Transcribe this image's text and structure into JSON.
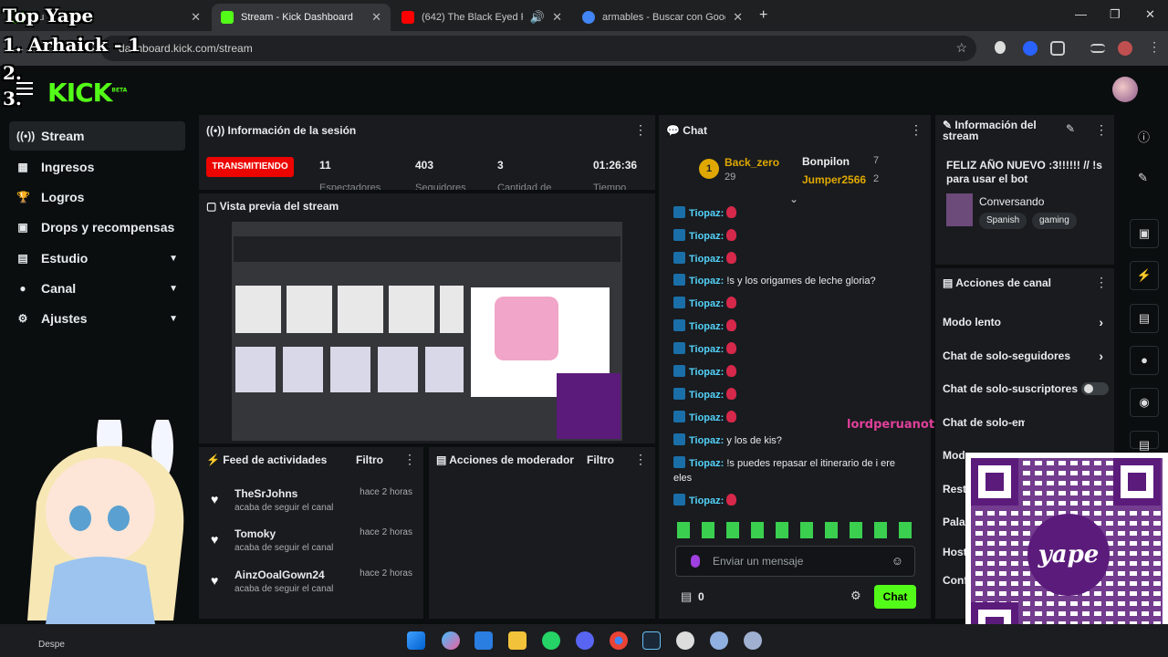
{
  "browser": {
    "tabs": [
      {
        "label": "Tu",
        "favicon_color": "#53fc18"
      },
      {
        "label": "Stream - Kick Dashboard",
        "favicon_color": "#53fc18"
      },
      {
        "label": "(642) The Black Eyed Peas -",
        "favicon_color": "#ff0000"
      },
      {
        "label": "armables - Buscar con Google",
        "favicon_color": "#4285f4"
      }
    ],
    "new_tab": "+",
    "url": "dashboard.kick.com/stream"
  },
  "overlay": {
    "top_yape": "Top Yape",
    "rank1": "1. Arhaick - 1",
    "rank2": "2.",
    "rank3": "3."
  },
  "header": {
    "logo": "KICK",
    "logo_badge": "BETA"
  },
  "sidebar": {
    "items": [
      {
        "label": "Stream",
        "icon": "broadcast-icon"
      },
      {
        "label": "Ingresos",
        "icon": "money-icon"
      },
      {
        "label": "Logros",
        "icon": "trophy-icon"
      },
      {
        "label": "Drops y recompensas",
        "icon": "gift-icon"
      },
      {
        "label": "Estudio",
        "icon": "studio-icon"
      },
      {
        "label": "Canal",
        "icon": "person-icon"
      },
      {
        "label": "Ajustes",
        "icon": "gear-icon"
      }
    ]
  },
  "session": {
    "title": "Información de la sesión",
    "status": "TRANSMITIENDO",
    "stats": [
      {
        "value": "11",
        "label": "Espectadores"
      },
      {
        "value": "403",
        "label": "Seguidores"
      },
      {
        "value": "3",
        "label": "Cantidad de"
      },
      {
        "value": "01:26:36",
        "label": "Tiempo"
      }
    ]
  },
  "preview": {
    "title": "Vista previa del stream"
  },
  "feed": {
    "title": "Feed de actividades",
    "filter": "Filtro",
    "items": [
      {
        "name": "TheSrJohns",
        "action": "acaba de seguir el canal",
        "time": "hace 2 horas"
      },
      {
        "name": "Tomoky",
        "action": "acaba de seguir el canal",
        "time": "hace 2 horas"
      },
      {
        "name": "AinzOoalGown24",
        "action": "acaba de seguir el canal",
        "time": "hace 2 horas"
      }
    ]
  },
  "mod": {
    "title": "Acciones de moderador",
    "filter": "Filtro"
  },
  "chat": {
    "title": "Chat",
    "leaderboard": [
      {
        "rank": "1",
        "name": "Back_zero",
        "points": "29"
      },
      {
        "name": "Bonpilon",
        "points": "7"
      },
      {
        "name": "Jumper2566",
        "points": "2"
      }
    ],
    "messages": [
      {
        "user": "Tiopaz:",
        "text": ""
      },
      {
        "user": "Tiopaz:",
        "text": ""
      },
      {
        "user": "Tiopaz:",
        "text": ""
      },
      {
        "user": "Tiopaz:",
        "text": "!s y los origames de leche gloria?"
      },
      {
        "user": "Tiopaz:",
        "text": ""
      },
      {
        "user": "Tiopaz:",
        "text": ""
      },
      {
        "user": "Tiopaz:",
        "text": ""
      },
      {
        "user": "Tiopaz:",
        "text": ""
      },
      {
        "user": "Tiopaz:",
        "text": ""
      },
      {
        "user": "Tiopaz:",
        "text": ""
      },
      {
        "user": "Tiopaz:",
        "text": "y los de kis?"
      },
      {
        "user": "Tiopaz:",
        "text": "!s puedes repasar el itinerario de i ere eles"
      },
      {
        "user": "Tiopaz:",
        "text": ""
      }
    ],
    "floating_user": "lordperuanotm3_",
    "input_placeholder": "Enviar un mensaje",
    "points": "0",
    "send": "Chat"
  },
  "stream_info": {
    "title": "Información del stream",
    "stream_title": "FELIZ AÑO NUEVO :3!!!!!! // !s para usar el bot",
    "category": "Conversando",
    "tags": [
      "Spanish",
      "gaming"
    ]
  },
  "channel_actions": {
    "title": "Acciones de canal",
    "rows": [
      {
        "label": "Modo lento"
      },
      {
        "label": "Chat de solo-seguidores"
      },
      {
        "label": "Chat de solo-suscriptores"
      },
      {
        "label": "Chat de solo-emotes"
      },
      {
        "label": "Modo"
      },
      {
        "label": "Restr"
      },
      {
        "label": "Palab"
      },
      {
        "label": "Host"
      },
      {
        "label": "Conf"
      }
    ]
  },
  "qr": {
    "brand": "yape"
  },
  "taskbar": {
    "label": "Despe"
  }
}
